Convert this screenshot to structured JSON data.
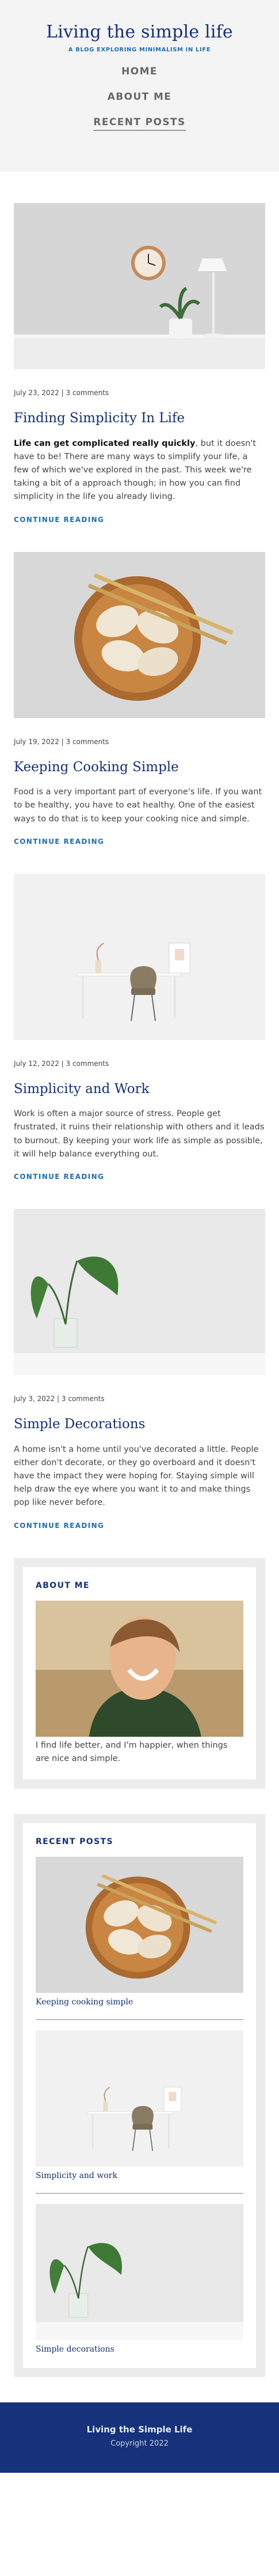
{
  "site": {
    "title": "Living the simple life",
    "tagline": "A BLOG EXPLORING MINIMALISM IN LIFE"
  },
  "nav": [
    {
      "label": "HOME"
    },
    {
      "label": "ABOUT ME"
    },
    {
      "label": "RECENT POSTS"
    }
  ],
  "posts": [
    {
      "meta": "July 23, 2022 | 3 comments",
      "title": "Finding Simplicity In Life",
      "excerpt_bold": "Life can get complicated really quickly",
      "excerpt": ", but it doesn't have to be! There are many ways to simplify your life, a few of which we've explored in the past. This week we're taking a bit of a approach though; in how you can find simplicity in the life you already living.",
      "read_more": "CONTINUE READING"
    },
    {
      "meta": "July 19, 2022 | 3 comments",
      "title": "Keeping Cooking Simple",
      "excerpt": "Food is a very important part of everyone's life. If you want to be healthy, you have to eat healthy. One of the easiest ways to do that is to keep your cooking nice and simple.",
      "read_more": "CONTINUE READING"
    },
    {
      "meta": "July 12, 2022 | 3 comments",
      "title": "Simplicity and Work",
      "excerpt": "Work is often a major source of stress. People get frustrated, it ruins their relationship with others and it leads to burnout. By keeping your work life as simple as possible, it will help balance everything out.",
      "read_more": "CONTINUE READING"
    },
    {
      "meta": "July 3, 2022 | 3 comments",
      "title": "Simple Decorations",
      "excerpt": "A home isn't a home until you've decorated a little. People either don't decorate, or they go overboard and it doesn't have the impact they were hoping for. Staying simple will help draw the eye where you want it to and make things pop like never before.",
      "read_more": "CONTINUE READING"
    }
  ],
  "about": {
    "title": "ABOUT ME",
    "text": "I find life better, and I'm happier, when things are nice and simple."
  },
  "recent": {
    "title": "RECENT POSTS",
    "items": [
      {
        "label": "Keeping cooking simple"
      },
      {
        "label": "Simplicity and work"
      },
      {
        "label": "Simple decorations"
      }
    ]
  },
  "footer": {
    "title": "Living the Simple Life",
    "copyright": "Copyright 2022"
  },
  "colors": {
    "primary": "#14307a",
    "accent": "#1b6fb5",
    "header_bg": "#f4f4f4",
    "footer_bg": "#15327a"
  }
}
